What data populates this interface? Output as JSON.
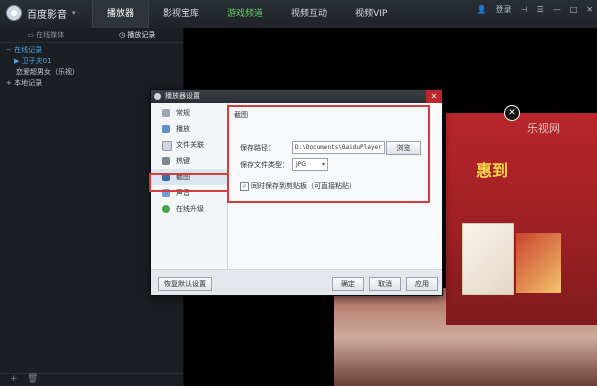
{
  "app": {
    "name": "百度影音"
  },
  "nav": {
    "tabs": [
      "播放器",
      "影视宝库",
      "游戏频道",
      "视频互动",
      "视频VIP"
    ],
    "active_index": 0
  },
  "window": {
    "login": "登录"
  },
  "sidebar": {
    "tabs": [
      "在线媒体",
      "播放记录"
    ],
    "online_records": "在线记录",
    "selected_item": "卫子夫01",
    "item": "恋爱超男女（乐视）",
    "local_records": "本地记录"
  },
  "video": {
    "watermark": "乐视网",
    "ad_text": "惠到",
    "close_symbol": "✕"
  },
  "dialog": {
    "title": "播放器设置",
    "close_symbol": "✕",
    "categories": [
      "常规",
      "播放",
      "文件关联",
      "热键",
      "截图",
      "声音",
      "在线升级"
    ],
    "active_category": "截图",
    "section_title": "截图",
    "save_path_label": "保存路径：",
    "save_path_value": "D:\\Documents\\BaiduPlayer",
    "browse_label": "浏览",
    "file_type_label": "保存文件类型：",
    "file_type_value": "JPG",
    "clipboard_checked": true,
    "clipboard_label": "同时保存到剪贴板（可直接粘贴）",
    "buttons": {
      "restore_defaults": "恢复默认设置",
      "ok": "确定",
      "cancel": "取消",
      "apply": "应用"
    }
  },
  "colors": {
    "highlight": "#d43b3b",
    "accent_blue": "#4ea6e8",
    "game_green": "#5bd15b"
  }
}
